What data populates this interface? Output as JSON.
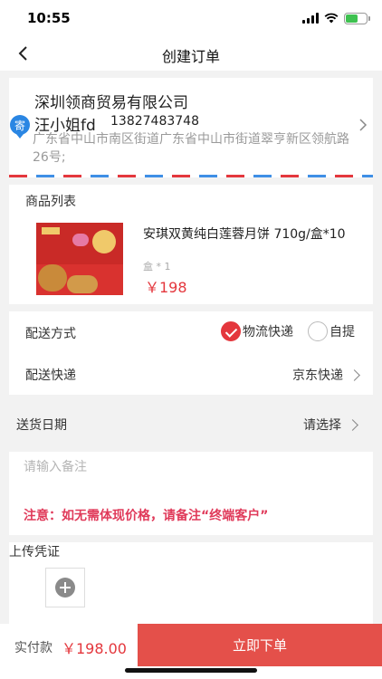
{
  "status_bar": {
    "time": "10:55",
    "battery_level": 0.6,
    "battery_color": "#3ec150"
  },
  "nav": {
    "title": "创建订单",
    "back_icon": "chevron-left-icon"
  },
  "address": {
    "sender_tag": "寄",
    "company": "深圳领商贸易有限公司",
    "name": "汪小姐fd",
    "phone": "13827483748",
    "detail": "广东省中山市南区街道广东省中山市街道翠亨新区领航路26号;"
  },
  "goods": {
    "section_title": "商品列表",
    "items": [
      {
        "name": "安琪双黄纯白莲蓉月饼 710g/盒*10",
        "spec": "盒 * 1",
        "price": "￥198"
      }
    ]
  },
  "delivery": {
    "method_label": "配送方式",
    "options": [
      {
        "label": "物流快递",
        "checked": true
      },
      {
        "label": "自提",
        "checked": false
      }
    ],
    "courier_label": "配送快递",
    "courier_value": "京东快递"
  },
  "date": {
    "label": "送货日期",
    "value": "请选择"
  },
  "remark": {
    "placeholder": "请输入备注",
    "note": "注意：如无需体现价格，请备注“终端客户”"
  },
  "upload": {
    "title": "上传凭证",
    "icon": "plus-icon"
  },
  "footer": {
    "pay_label": "实付款",
    "pay_amount": "￥198.00",
    "submit_label": "立即下单"
  },
  "colors": {
    "accent": "#e4373d",
    "button": "#e4504a",
    "link_blue": "#2a86e3",
    "note": "#e03a5a"
  }
}
